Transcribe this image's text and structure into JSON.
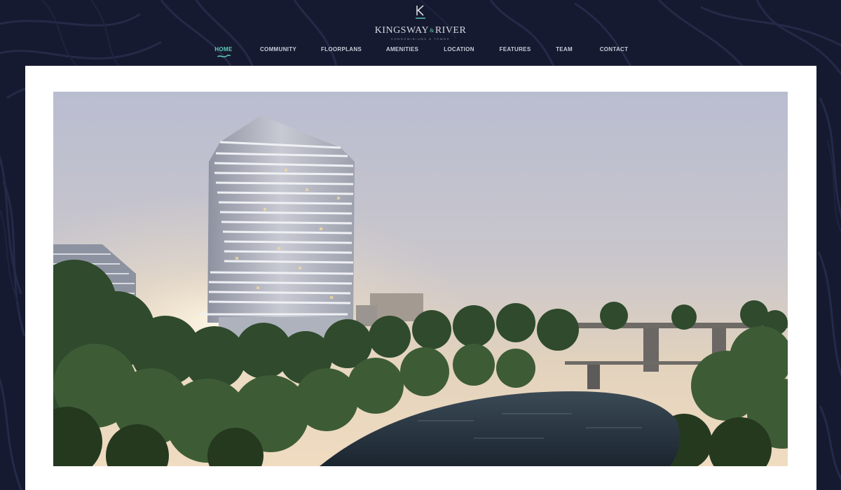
{
  "brand": {
    "logo_letter": "K",
    "name_left": "KINGSWAY",
    "name_amp": "&",
    "name_right": "RIVER",
    "tagline": "CONDOMINIUMS & TOWNS"
  },
  "nav": {
    "items": [
      {
        "label": "HOME",
        "active": true
      },
      {
        "label": "COMMUNITY",
        "active": false
      },
      {
        "label": "FLOORPLANS",
        "active": false
      },
      {
        "label": "AMENITIES",
        "active": false
      },
      {
        "label": "LOCATION",
        "active": false
      },
      {
        "label": "FEATURES",
        "active": false
      },
      {
        "label": "TEAM",
        "active": false
      },
      {
        "label": "CONTACT",
        "active": false
      }
    ]
  },
  "colors": {
    "background": "#161a30",
    "accent": "#5fcbb9",
    "nav_text": "#c9ccd8",
    "panel": "#ffffff"
  },
  "icons": {
    "logo": "k-monogram-icon",
    "nav_indicator": "wave-underline-icon"
  },
  "hero": {
    "image": "rendering of a residential condominium tower beside a wooded river valley with a railway bridge at sunset"
  }
}
